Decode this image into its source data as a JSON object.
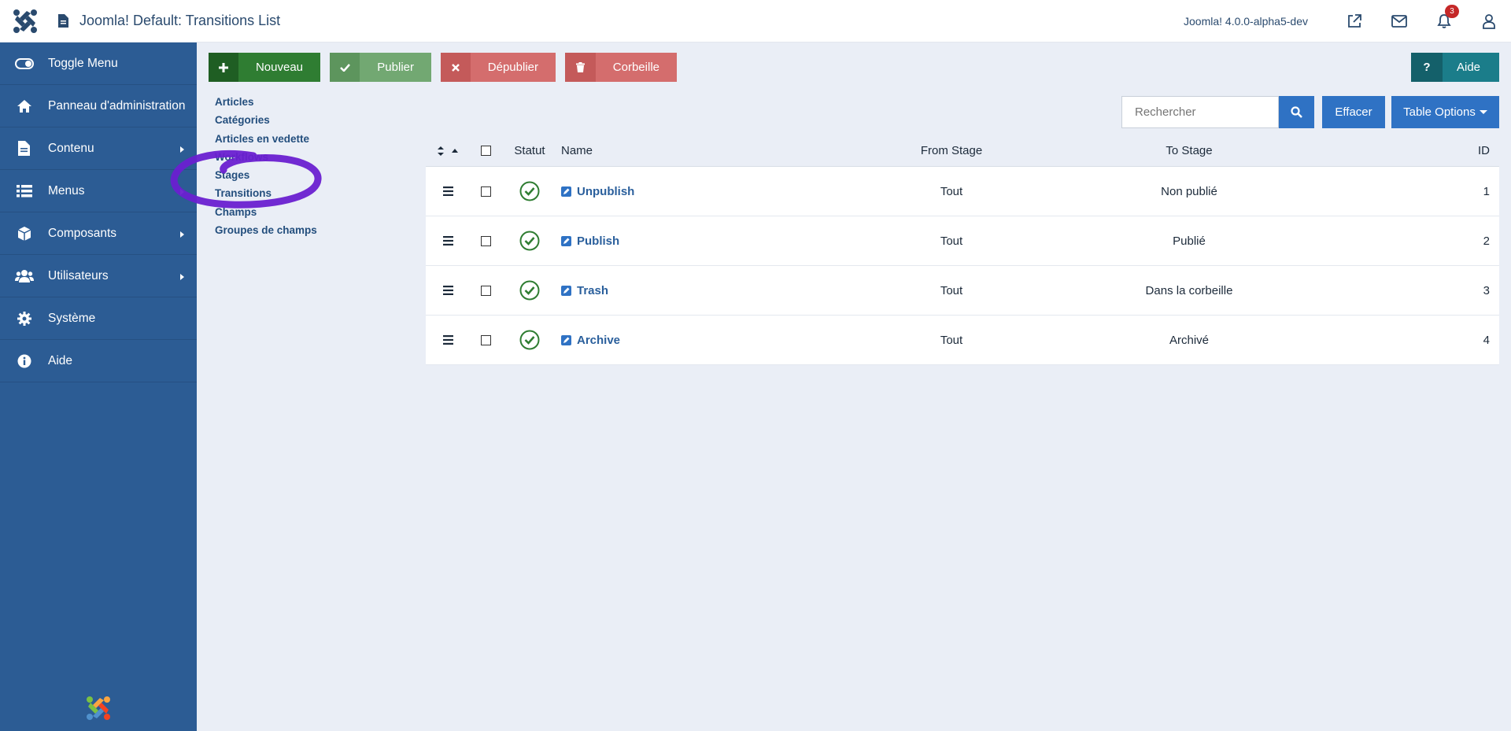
{
  "header": {
    "title": "Joomla! Default: Transitions List",
    "version": "Joomla! 4.0.0-alpha5-dev",
    "notifications_count": "3"
  },
  "sidebar": {
    "items": [
      {
        "label": "Toggle Menu",
        "icon": "toggle-icon"
      },
      {
        "label": "Panneau d'administration",
        "icon": "home-icon"
      },
      {
        "label": "Contenu",
        "icon": "file-icon"
      },
      {
        "label": "Menus",
        "icon": "list-icon"
      },
      {
        "label": "Composants",
        "icon": "cube-icon"
      },
      {
        "label": "Utilisateurs",
        "icon": "users-icon"
      },
      {
        "label": "Système",
        "icon": "gear-icon"
      },
      {
        "label": "Aide",
        "icon": "info-icon"
      }
    ]
  },
  "toolbar": {
    "new_label": "Nouveau",
    "publish_label": "Publier",
    "unpublish_label": "Dépublier",
    "trash_label": "Corbeille",
    "help_label": "Aide",
    "help_icon_text": "?"
  },
  "subnav": {
    "items": [
      "Articles",
      "Catégories",
      "Articles en vedette",
      "Workflows",
      "Stages",
      "Transitions",
      "Champs",
      "Groupes de champs"
    ]
  },
  "search": {
    "placeholder": "Rechercher",
    "clear_label": "Effacer",
    "options_label": "Table Options"
  },
  "table": {
    "columns": {
      "status": "Statut",
      "name": "Name",
      "from": "From Stage",
      "to": "To Stage",
      "id": "ID"
    },
    "rows": [
      {
        "name": "Unpublish",
        "from": "Tout",
        "to": "Non publié",
        "id": "1"
      },
      {
        "name": "Publish",
        "from": "Tout",
        "to": "Publié",
        "id": "2"
      },
      {
        "name": "Trash",
        "from": "Tout",
        "to": "Dans la corbeille",
        "id": "3"
      },
      {
        "name": "Archive",
        "from": "Tout",
        "to": "Archivé",
        "id": "4"
      }
    ]
  },
  "colors": {
    "sidebar": "#2c5c94",
    "primary": "#2f72c4",
    "success": "#2f7d32",
    "danger": "#d46d6d",
    "annotation": "#6a1fd0"
  }
}
